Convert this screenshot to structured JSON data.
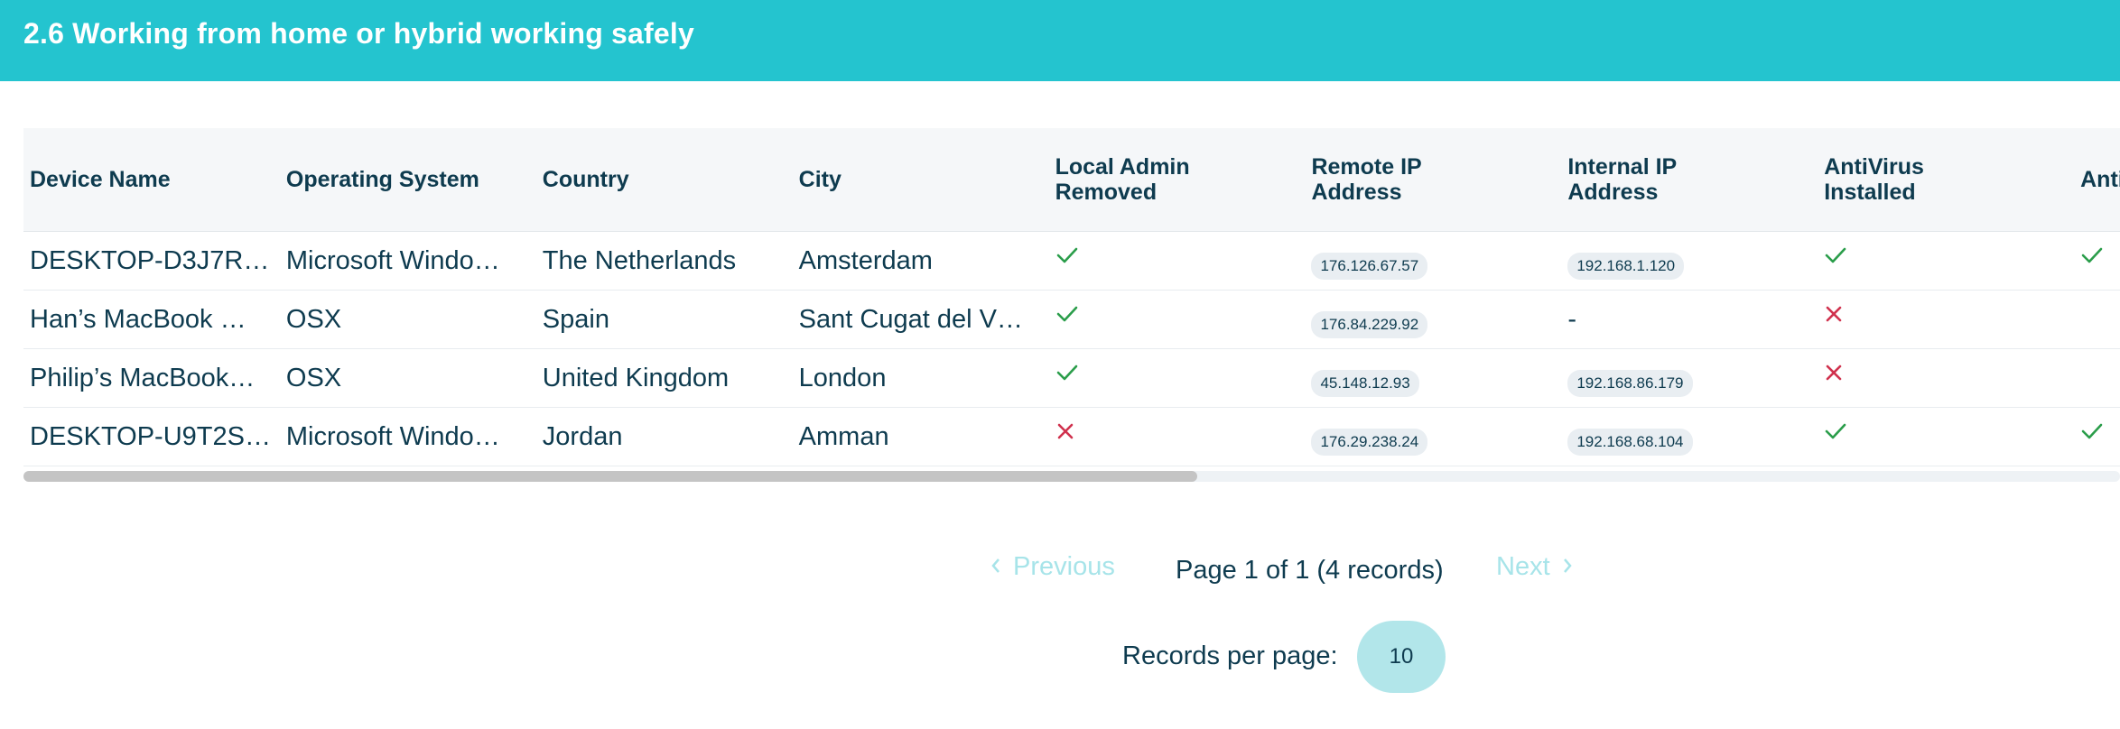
{
  "header": {
    "title": "2.6 Working from home or hybrid working safely"
  },
  "table": {
    "columns": [
      {
        "label": "Device Name"
      },
      {
        "label": "Operating System"
      },
      {
        "label": "Country"
      },
      {
        "label": "City"
      },
      {
        "label": "Local Admin Removed"
      },
      {
        "label": "Remote IP Address"
      },
      {
        "label": "Internal IP Address"
      },
      {
        "label": "AntiVirus Installed"
      },
      {
        "label": "AntiVirus Enabled"
      }
    ],
    "rows": [
      {
        "device": "DESKTOP-D3J7R…",
        "os": "Microsoft Windo…",
        "country": "The Netherlands",
        "city": "Amsterdam",
        "local_admin_removed": "check-icon",
        "remote_ip": "176.126.67.57",
        "internal_ip": "192.168.1.120",
        "av_installed": "check-icon",
        "av_enabled": "check-icon"
      },
      {
        "device": "Han’s MacBook …",
        "os": "OSX",
        "country": "Spain",
        "city": "Sant Cugat del V…",
        "local_admin_removed": "check-icon",
        "remote_ip": "176.84.229.92",
        "internal_ip": "-",
        "av_installed": "cross-icon",
        "av_enabled": ""
      },
      {
        "device": "Philip’s MacBook…",
        "os": "OSX",
        "country": "United Kingdom",
        "city": "London",
        "local_admin_removed": "check-icon",
        "remote_ip": "45.148.12.93",
        "internal_ip": "192.168.86.179",
        "av_installed": "cross-icon",
        "av_enabled": ""
      },
      {
        "device": "DESKTOP-U9T2S…",
        "os": "Microsoft Windo…",
        "country": "Jordan",
        "city": "Amman",
        "local_admin_removed": "cross-icon",
        "remote_ip": "176.29.238.24",
        "internal_ip": "192.168.68.104",
        "av_installed": "check-icon",
        "av_enabled": "check-icon"
      }
    ]
  },
  "pagination": {
    "previous_label": "Previous",
    "next_label": "Next",
    "page_info": "Page 1 of 1 (4 records)",
    "records_per_page_label": "Records per page:",
    "records_per_page_value": "10"
  },
  "colors": {
    "header_bg": "#24c4cf",
    "check": "#2a9d4a",
    "cross": "#d0314d",
    "disabled_link": "#a7e4e9"
  }
}
